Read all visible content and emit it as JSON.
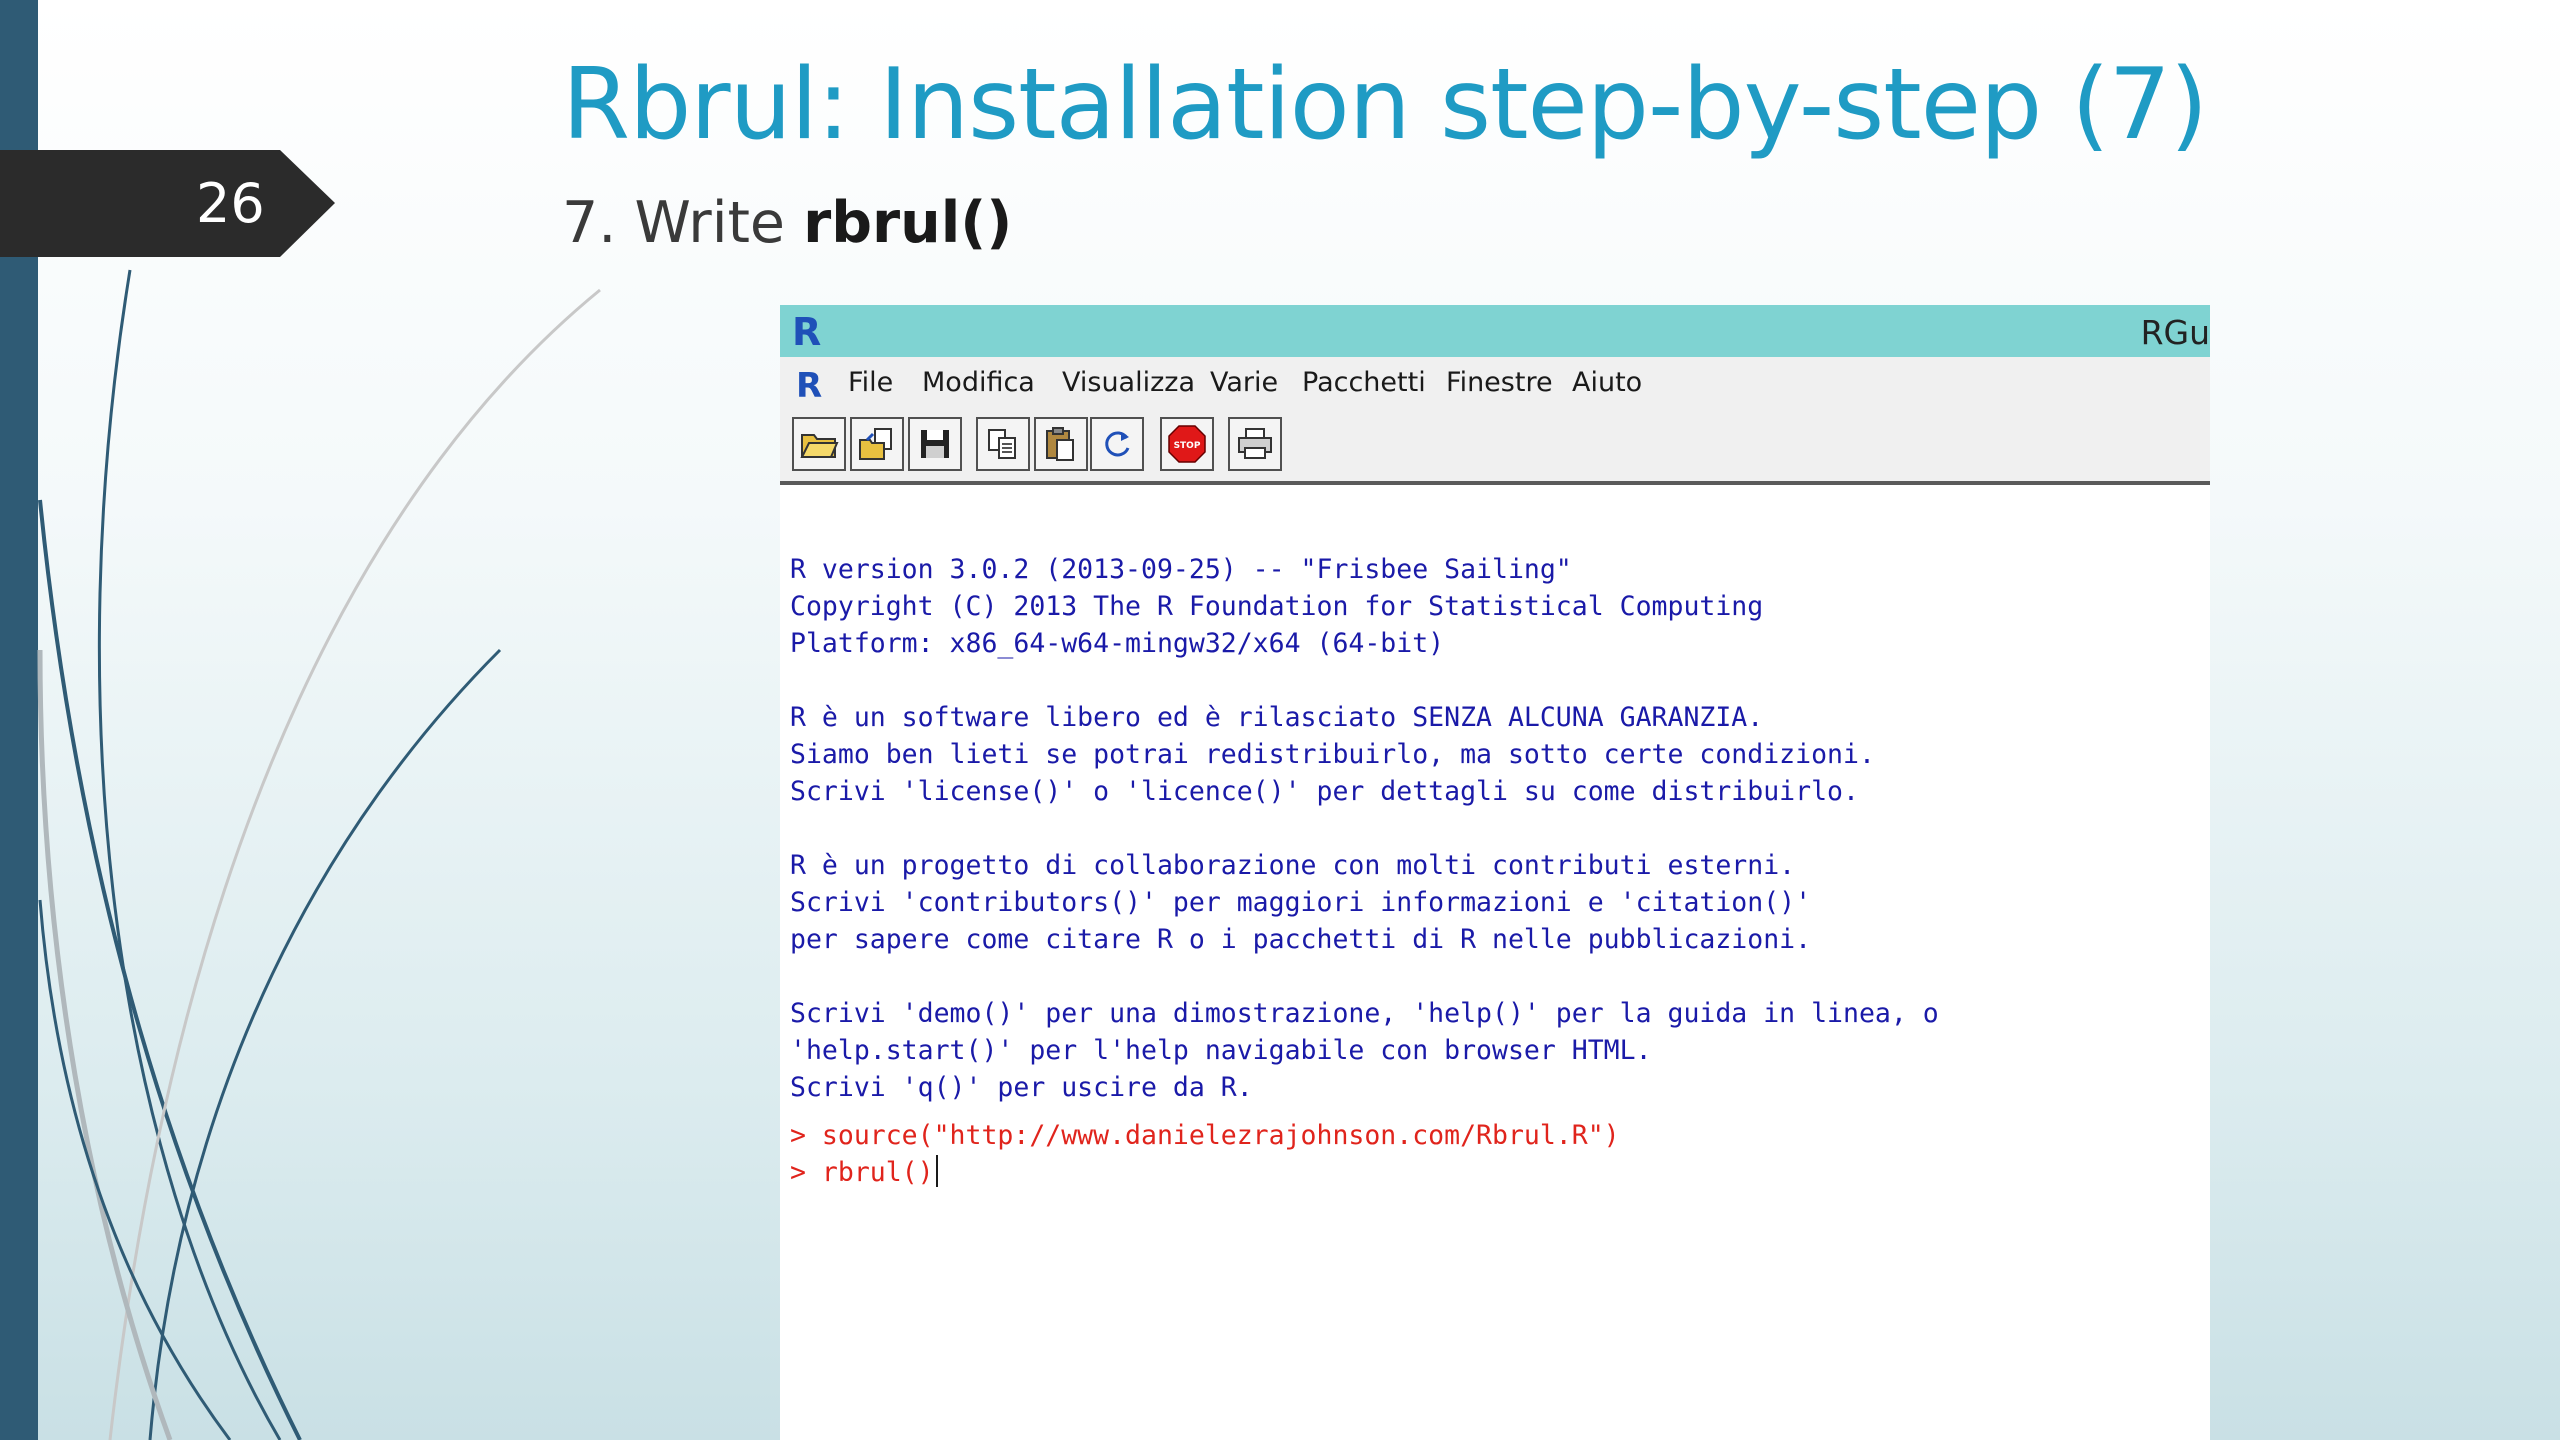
{
  "slide": {
    "number": "26",
    "title": "Rbrul: Installation step-by-step (7)",
    "subtitle_prefix": "7. Write ",
    "subtitle_code": "rbrul()"
  },
  "window": {
    "title": "RGu",
    "menu": [
      "File",
      "Modifica",
      "Visualizza",
      "Varie",
      "Pacchetti",
      "Finestre",
      "Aiuto"
    ],
    "toolbar": [
      "open-script-icon",
      "load-workspace-icon",
      "save-workspace-icon",
      "copy-icon",
      "paste-icon",
      "copy-paste-icon",
      "stop-icon",
      "print-icon"
    ],
    "stop_label": "STOP"
  },
  "console": {
    "output": "R version 3.0.2 (2013-09-25) -- \"Frisbee Sailing\"\nCopyright (C) 2013 The R Foundation for Statistical Computing\nPlatform: x86_64-w64-mingw32/x64 (64-bit)\n\nR è un software libero ed è rilasciato SENZA ALCUNA GARANZIA.\nSiamo ben lieti se potrai redistribuirlo, ma sotto certe condizioni.\nScrivi 'license()' o 'licence()' per dettagli su come distribuirlo.\n\nR è un progetto di collaborazione con molti contributi esterni.\nScrivi 'contributors()' per maggiori informazioni e 'citation()'\nper sapere come citare R o i pacchetti di R nelle pubblicazioni.\n\nScrivi 'demo()' per una dimostrazione, 'help()' per la guida in linea, o\n'help.start()' per l'help navigabile con browser HTML.\nScrivi 'q()' per uscire da R.",
    "command1": "> source(\"http://www.danielezrajohnson.com/Rbrul.R\")",
    "command2": "> rbrul()"
  },
  "colors": {
    "title": "#1f9bc4",
    "console_text": "#1a1aa8",
    "console_command": "#e0241c",
    "titlebar": "#7fd3d2",
    "left_bar": "#2f5b75"
  }
}
